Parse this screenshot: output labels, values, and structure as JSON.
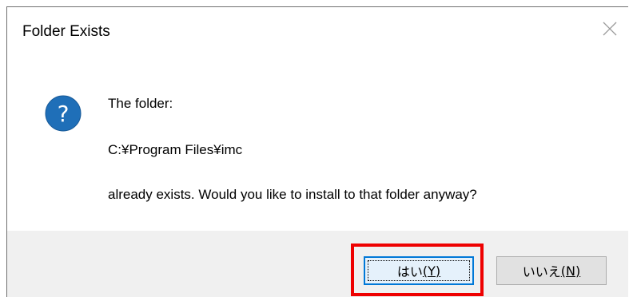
{
  "dialog": {
    "title": "Folder Exists",
    "close_icon": "close-icon",
    "question_icon": "question-icon",
    "message_line1": "The folder:",
    "message_line2": "C:¥Program Files¥imc",
    "message_line3": "already exists. Would you like to install to that folder anyway?",
    "yes_button": {
      "label": "はい",
      "accelerator": "(Y)",
      "focused": true,
      "highlight_color": "#ee0000"
    },
    "no_button": {
      "label": "いいえ",
      "accelerator": "(N)"
    }
  },
  "colors": {
    "icon_blue": "#1f6fb8",
    "footer_bg": "#f0f0f0",
    "focus_border": "#0078d7",
    "annotation_red": "#ee0000"
  }
}
